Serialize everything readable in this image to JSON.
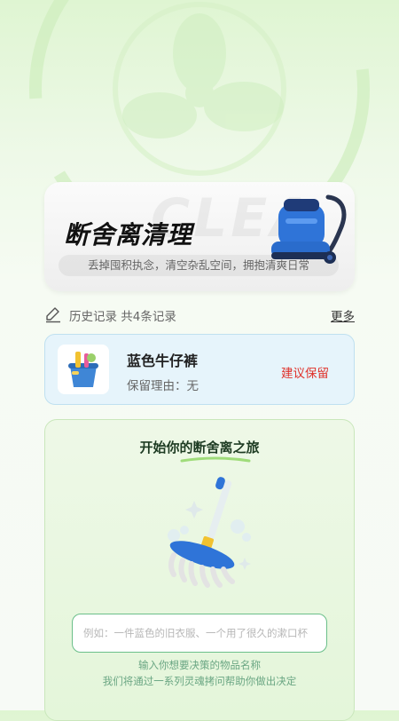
{
  "hero": {
    "title": "断舍离清理",
    "watermark": "CLEA",
    "subtitle": "丢掉囤积执念，清空杂乱空间，拥抱清爽日常",
    "image": "vacuum-cleaner-illustration"
  },
  "history": {
    "label": "历史记录 共4条记录",
    "more_label": "更多",
    "icon": "edit-icon"
  },
  "records": [
    {
      "name": "蓝色牛仔裤",
      "reason": "保留理由：无",
      "advice": "建议保留",
      "thumbnail": "cleaning-bucket-icon"
    }
  ],
  "journey": {
    "title": "开始你的断舍离之旅",
    "image": "mop-illustration",
    "input_placeholder": "例如：一件蓝色的旧衣服、一个用了很久的漱口杯",
    "hint_line1": "输入你想要决策的物品名称",
    "hint_line2": "我们将通过一系列灵魂拷问帮助你做出决定"
  },
  "colors": {
    "accent_green": "#6bbf8a",
    "advice_red": "#e0312a",
    "card_blue": "#e6f4fb"
  }
}
